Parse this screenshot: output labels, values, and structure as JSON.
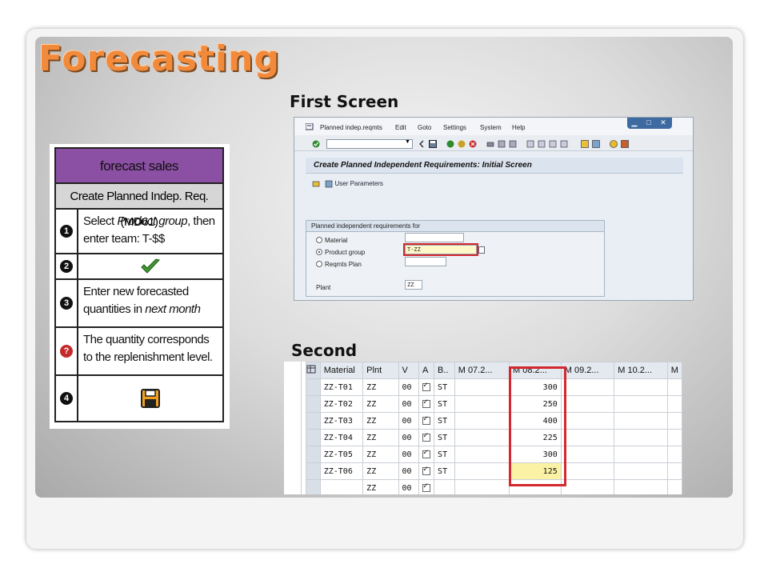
{
  "slide": {
    "title": "Forecasting",
    "caption_first": "First Screen",
    "caption_second": "Second"
  },
  "card": {
    "header": "forecast sales",
    "subheader": "Create Planned Indep. Req. (MD61)",
    "steps": [
      {
        "num": "1",
        "text_a": "Select ",
        "text_em": "Product group",
        "text_b": ", then enter team: T-$$"
      },
      {
        "num": "2",
        "icon": "green-checkmark-icon"
      },
      {
        "num": "3",
        "text_a": "Enter new forecasted quantities in ",
        "text_em": "next month",
        "text_b": ""
      },
      {
        "num": "?",
        "text_a": "The  quantity corresponds to the replenishment level.",
        "text_em": "",
        "text_b": ""
      },
      {
        "num": "4",
        "icon": "save-icon"
      }
    ]
  },
  "screen1": {
    "menu": [
      "Planned indep.reqmts",
      "Edit",
      "Goto",
      "Settings",
      "System",
      "Help"
    ],
    "window_title": "Create Planned Independent Requirements: Initial Screen",
    "user_parameters": "User Parameters",
    "group_title": "Planned independent requirements for",
    "radio_material": "Material",
    "radio_product_group": "Product group",
    "radio_reqmts_plan": "Reqmts Plan",
    "product_group_value": "T-ZZ",
    "plant_label": "Plant",
    "plant_value": "ZZ"
  },
  "screen2": {
    "headers": [
      "Material",
      "Plnt",
      "V",
      "A",
      "B..",
      "M 07.2...",
      "M 08.2...",
      "M 09.2...",
      "M 10.2...",
      "M"
    ],
    "rows": [
      {
        "material": "ZZ-T01",
        "plant": "ZZ",
        "v": "00",
        "b": "ST",
        "m08": "300"
      },
      {
        "material": "ZZ-T02",
        "plant": "ZZ",
        "v": "00",
        "b": "ST",
        "m08": "250"
      },
      {
        "material": "ZZ-T03",
        "plant": "ZZ",
        "v": "00",
        "b": "ST",
        "m08": "400"
      },
      {
        "material": "ZZ-T04",
        "plant": "ZZ",
        "v": "00",
        "b": "ST",
        "m08": "225"
      },
      {
        "material": "ZZ-T05",
        "plant": "ZZ",
        "v": "00",
        "b": "ST",
        "m08": "300"
      },
      {
        "material": "ZZ-T06",
        "plant": "ZZ",
        "v": "00",
        "b": "ST",
        "m08": "125"
      },
      {
        "material": "",
        "plant": "ZZ",
        "v": "00",
        "b": "",
        "m08": ""
      }
    ]
  },
  "colors": {
    "title_orange": "#f28a3c",
    "card_header_purple": "#8b4fa3",
    "highlight_red": "#d3282f",
    "cell_yellow": "#fbf2a6"
  }
}
